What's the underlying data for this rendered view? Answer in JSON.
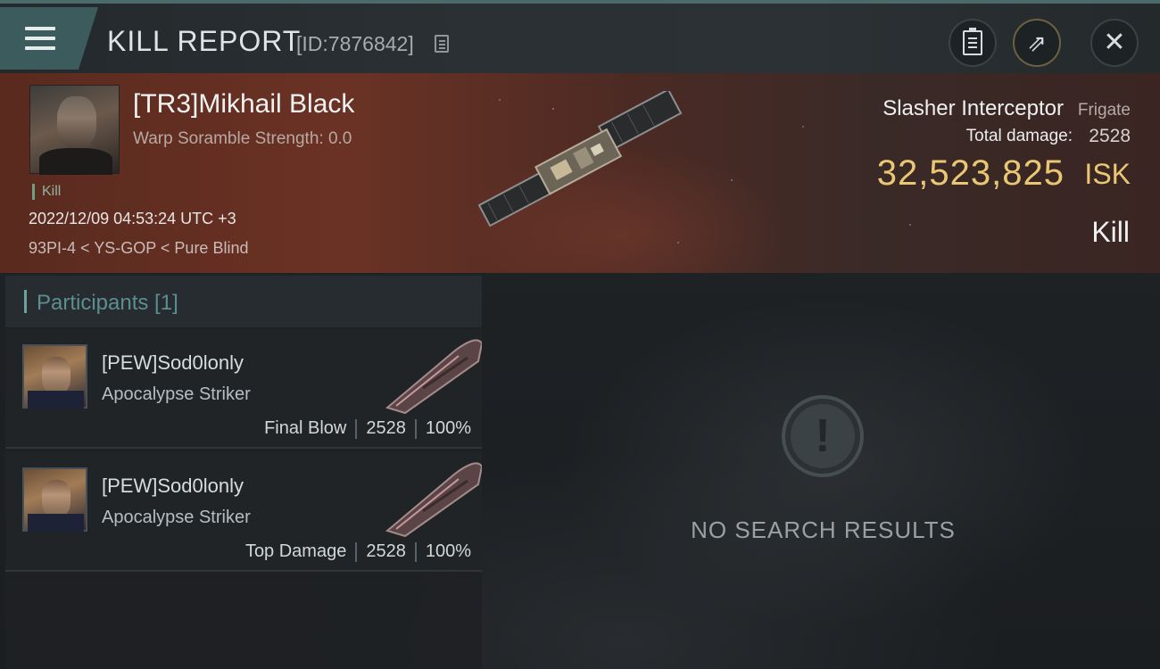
{
  "header": {
    "title": "KILL REPORT",
    "report_id": "[ID:7876842]",
    "menu_icon": "hamburger-icon",
    "buttons": [
      "notes-icon",
      "share-icon",
      "close-icon"
    ]
  },
  "victim": {
    "name": "[TR3]Mikhail Black",
    "scramble": "Warp Soramble Strength: 0.0",
    "tag": "Kill",
    "datetime": "2022/12/09 04:53:24 UTC +3",
    "location": "93PI-4 < YS-GOP < Pure Blind",
    "ship_name": "Slasher Interceptor",
    "ship_class": "Frigate",
    "damage_label": "Total damage:",
    "damage_value": "2528",
    "isk_value": "32,523,825",
    "isk_unit": "ISK",
    "result": "Kill"
  },
  "participants": {
    "label": "Participants [1]",
    "rows": [
      {
        "name": "[PEW]Sod0lonly",
        "ship": "Apocalypse Striker",
        "role": "Final Blow",
        "damage": "2528",
        "percent": "100%"
      },
      {
        "name": "[PEW]Sod0lonly",
        "ship": "Apocalypse Striker",
        "role": "Top Damage",
        "damage": "2528",
        "percent": "100%"
      }
    ]
  },
  "empty_state": {
    "icon": "exclamation-icon",
    "text": "NO SEARCH RESULTS"
  },
  "colors": {
    "accent_teal": "#4b6a6a",
    "isk_gold": "#e9c774",
    "kill_green": "#6f9e84"
  }
}
